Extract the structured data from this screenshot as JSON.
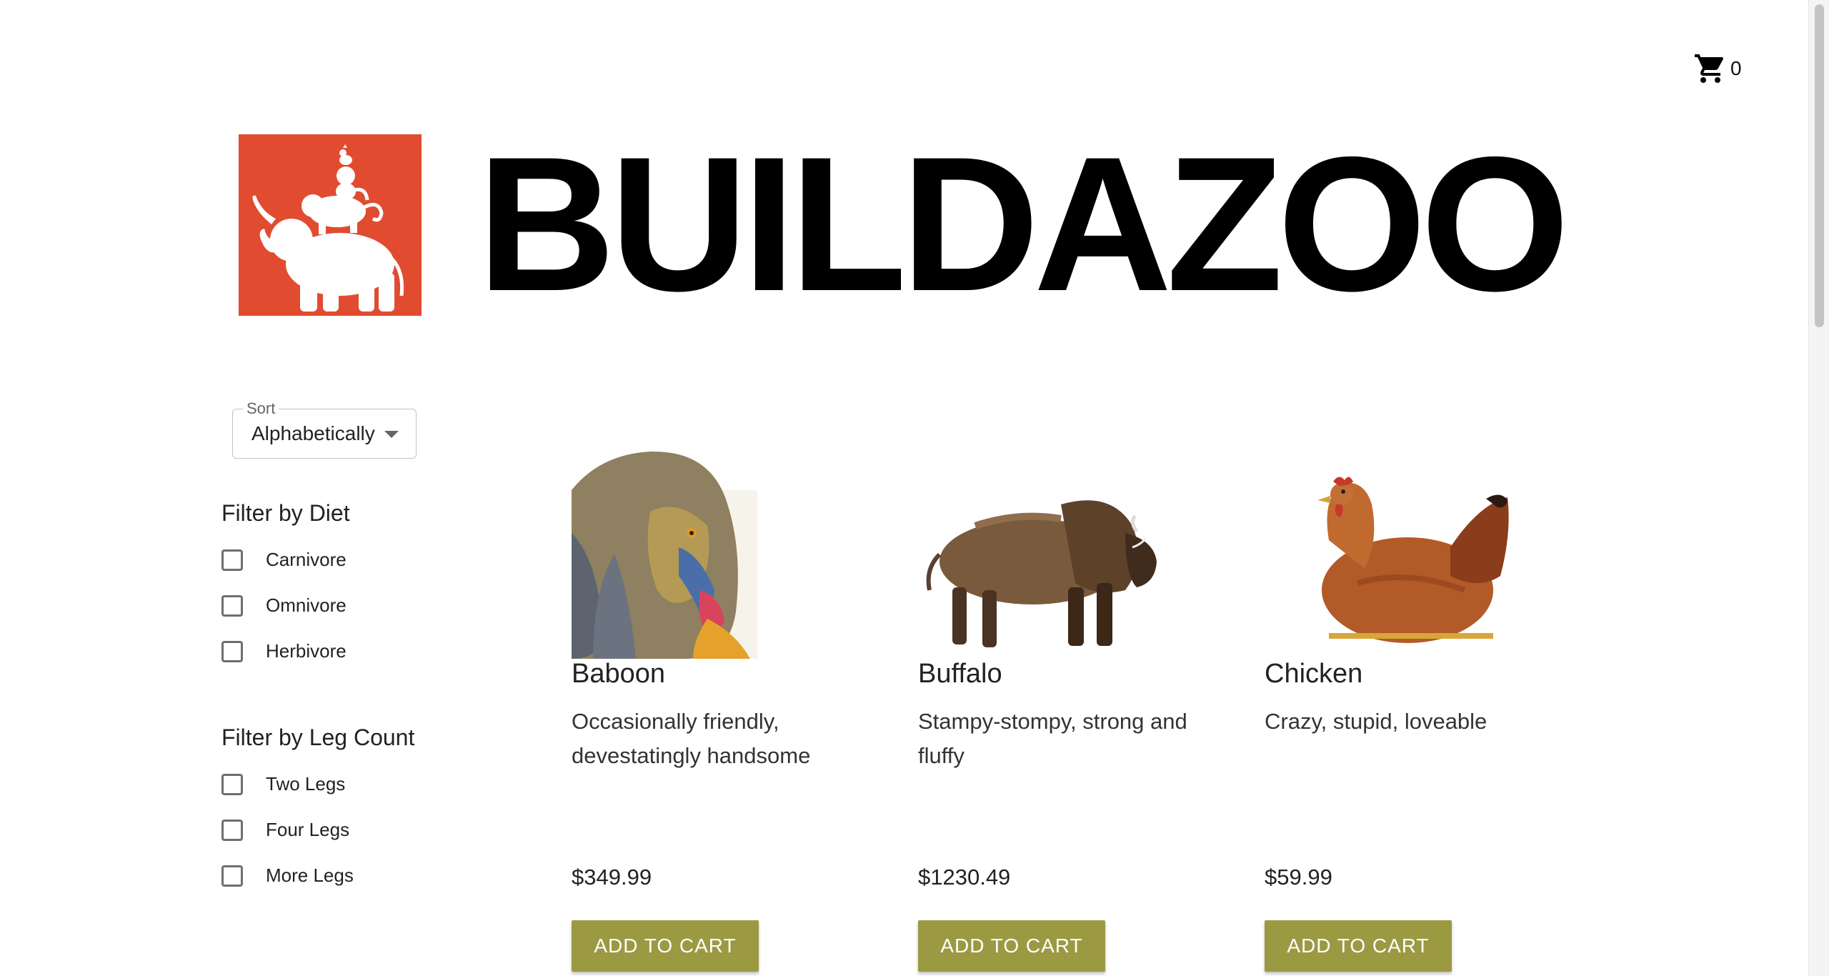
{
  "header": {
    "title": "BUILDAZOO",
    "cart_count": "0"
  },
  "sort": {
    "label": "Sort",
    "value": "Alphabetically"
  },
  "filters": {
    "diet": {
      "title": "Filter by Diet",
      "options": [
        "Carnivore",
        "Omnivore",
        "Herbivore"
      ]
    },
    "legs": {
      "title": "Filter by Leg Count",
      "options": [
        "Two Legs",
        "Four Legs",
        "More Legs"
      ]
    }
  },
  "products": [
    {
      "name": "Baboon",
      "description": "Occasionally friendly, devestatingly handsome",
      "price": "$349.99",
      "button": "ADD TO CART"
    },
    {
      "name": "Buffalo",
      "description": "Stampy-stompy, strong and fluffy",
      "price": "$1230.49",
      "button": "ADD TO CART"
    },
    {
      "name": "Chicken",
      "description": "Crazy, stupid, loveable",
      "price": "$59.99",
      "button": "ADD TO CART"
    }
  ],
  "colors": {
    "brand": "#e14b30",
    "button": "#9b9a43"
  },
  "icons": {
    "cart": "shopping-cart-icon",
    "logo": "stacked-animals-logo"
  }
}
